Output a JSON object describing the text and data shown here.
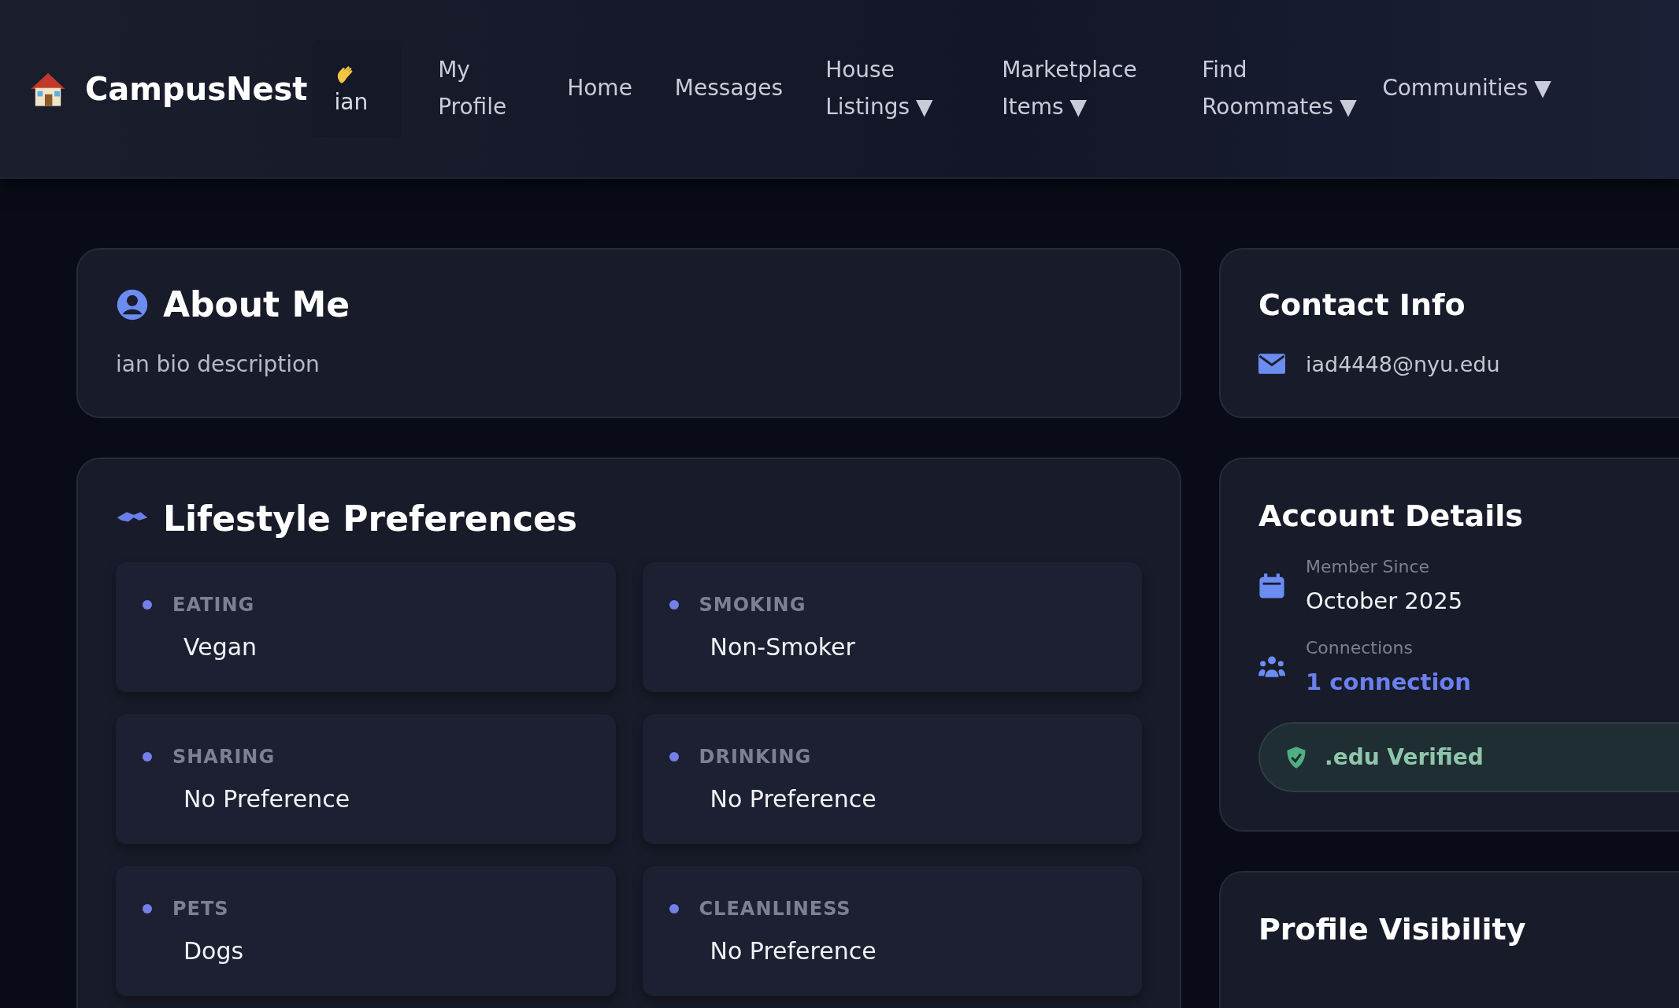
{
  "brand": {
    "name": "CampusNest"
  },
  "user_chip": {
    "name": "ian"
  },
  "nav": [
    {
      "label": "My Profile"
    },
    {
      "label": "Home"
    },
    {
      "label": "Messages"
    },
    {
      "label": "House Listings",
      "caret": "▼"
    },
    {
      "label": "Marketplace Items",
      "caret": "▼"
    },
    {
      "label": "Find Roommates",
      "caret": "▼"
    },
    {
      "label": "Communities",
      "caret": "▼"
    }
  ],
  "about": {
    "title": "About Me",
    "bio": "ian bio description"
  },
  "lifestyle": {
    "title": "Lifestyle Preferences",
    "items": [
      {
        "label": "EATING",
        "value": "Vegan"
      },
      {
        "label": "SMOKING",
        "value": "Non-Smoker"
      },
      {
        "label": "SHARING",
        "value": "No Preference"
      },
      {
        "label": "DRINKING",
        "value": "No Preference"
      },
      {
        "label": "PETS",
        "value": "Dogs"
      },
      {
        "label": "CLEANLINESS",
        "value": "No Preference"
      }
    ]
  },
  "contact": {
    "title": "Contact Info",
    "email": "iad4448@nyu.edu"
  },
  "account": {
    "title": "Account Details",
    "member_label": "Member Since",
    "member_value": "October 2025",
    "connections_label": "Connections",
    "connections_value": "1 connection",
    "badge": ".edu Verified"
  },
  "visibility": {
    "title": "Profile Visibility"
  }
}
